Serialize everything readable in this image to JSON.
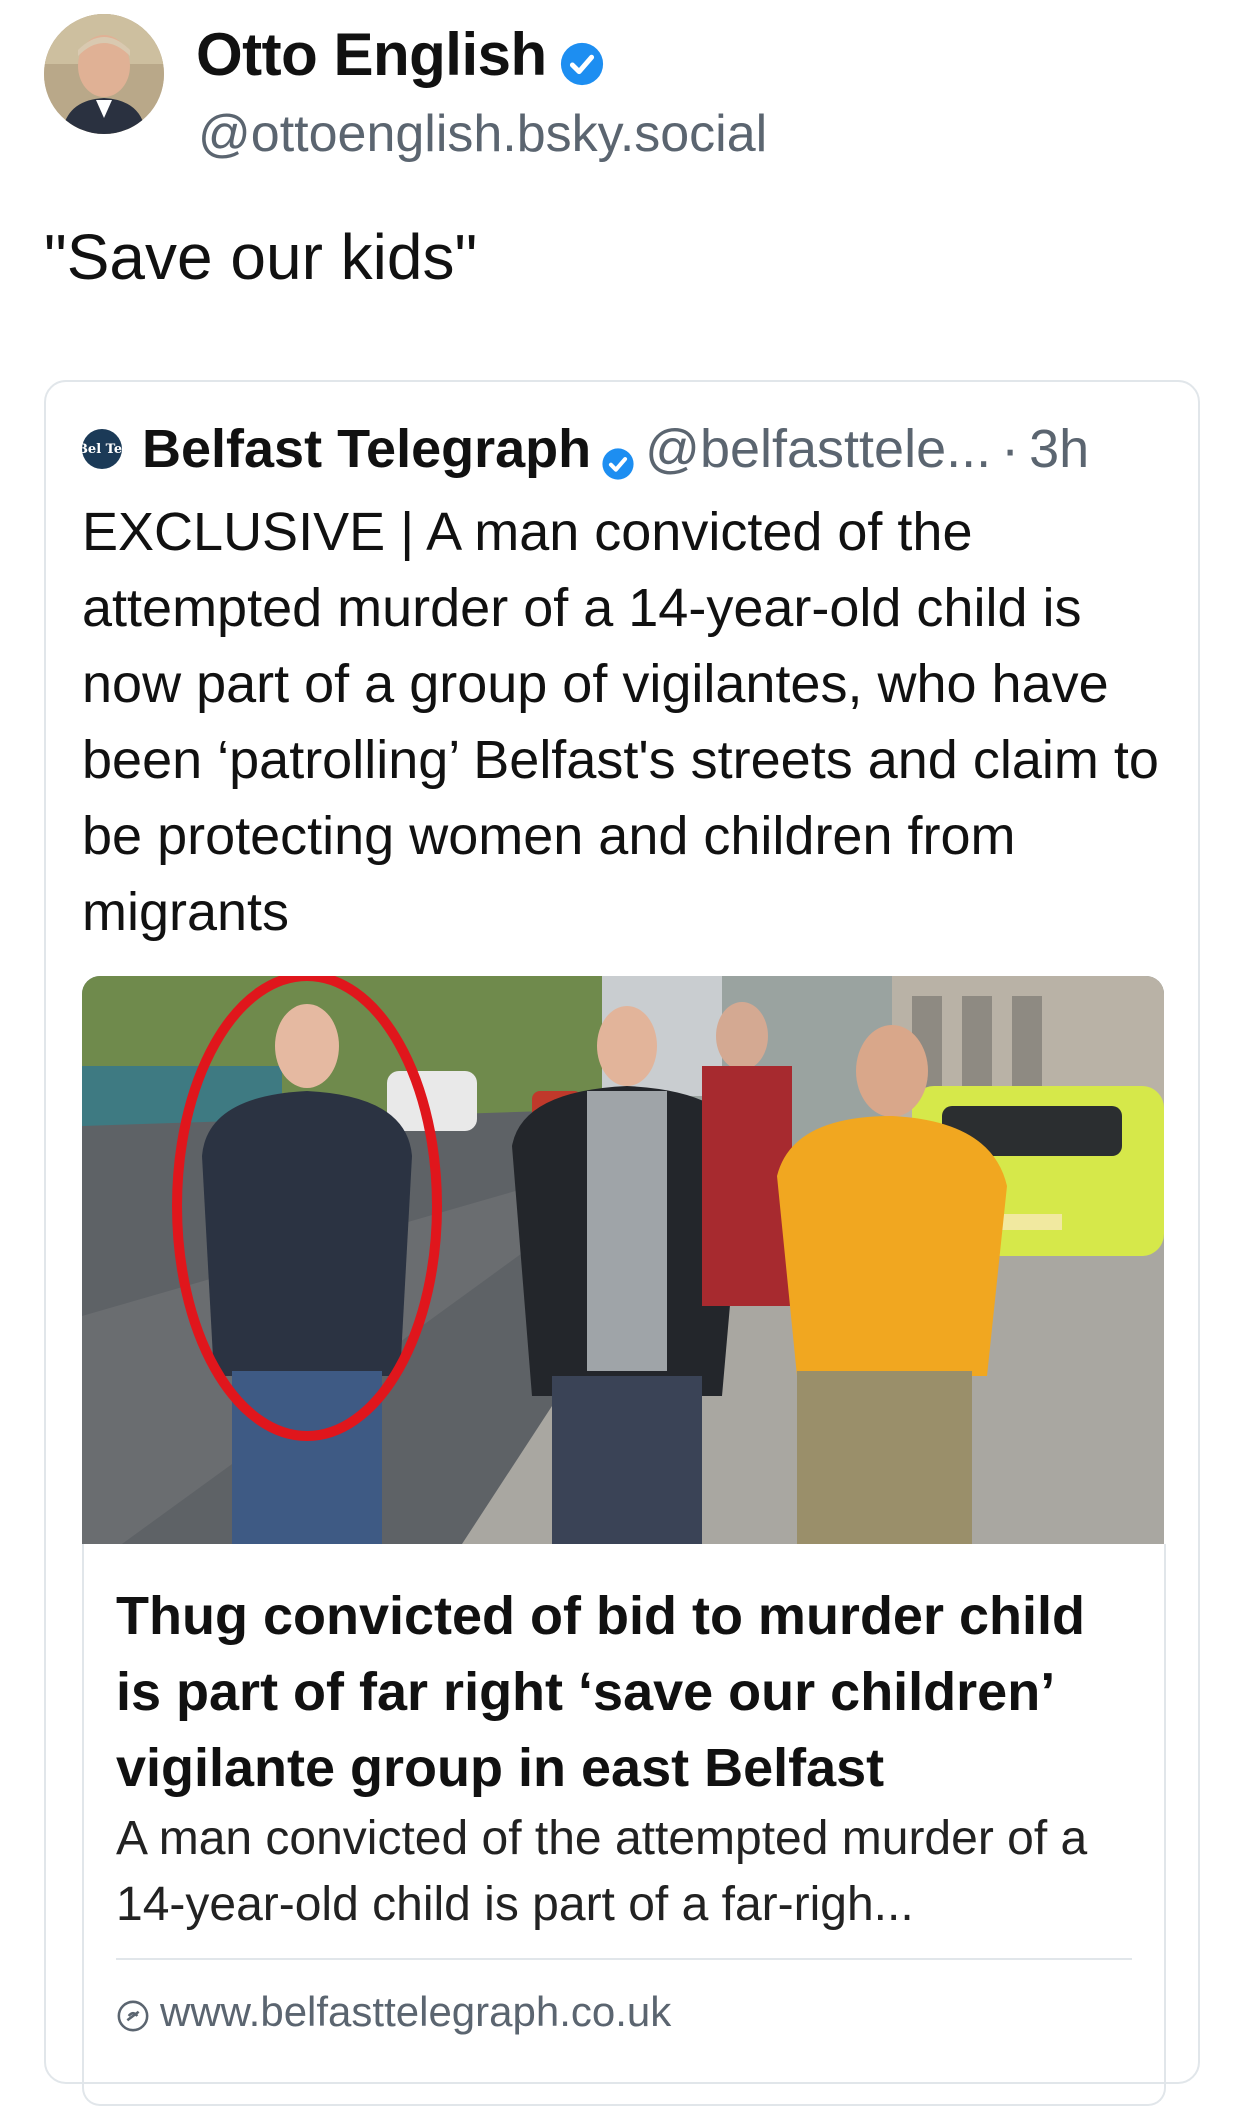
{
  "author": {
    "display_name": "Otto English",
    "handle": "@ottoenglish.bsky.social",
    "avatar_icon": "avatar-photo",
    "verified_icon": "verified-badge-icon"
  },
  "post": {
    "text": "\"Save our kids\""
  },
  "quote": {
    "source_logo_text": "Bel Tel",
    "display_name": "Belfast Telegraph",
    "handle": "@belfasttele...",
    "separator": "·",
    "time": "3h",
    "body": "EXCLUSIVE | A man convicted of the attempted murder of a 14-year-old child is now part of a group of vigilantes, who have been ‘patrolling’ Belfast's streets and claim to be protecting women and children from migrants"
  },
  "link_card": {
    "title": "Thug convicted of bid to murder child is part of far right ‘save our children’ vigilante group in east Belfast",
    "description": "A man convicted of the attempted murder of a 14-year-old child is part of a far-righ...",
    "domain": "www.belfasttelegraph.co.uk",
    "domain_icon": "globe-icon"
  },
  "colors": {
    "verified_blue": "#1d8ef1",
    "handle_gray": "#5b6570",
    "border_gray": "#e1e6ea",
    "circle_red": "#e0161c"
  }
}
